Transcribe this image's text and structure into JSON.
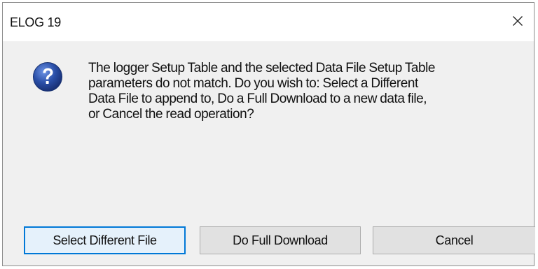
{
  "window": {
    "title": "ELOG 19",
    "close_icon": "close-icon"
  },
  "dialog": {
    "icon": "question-icon",
    "message_lines": [
      "The logger Setup Table and the selected Data File Setup Table",
      "parameters do not match. Do you wish to: Select a Different",
      "Data File to append to, Do a Full Download to a new data file,",
      "or Cancel the read operation?"
    ]
  },
  "buttons": {
    "select_different_file": "Select Different File",
    "do_full_download": "Do Full Download",
    "cancel": "Cancel"
  },
  "colors": {
    "accent": "#0078d7",
    "dialog_bg": "#f0f0f0",
    "titlebar_bg": "#ffffff",
    "button_bg": "#e1e1e1",
    "icon_blue": "#2a4fa8"
  }
}
